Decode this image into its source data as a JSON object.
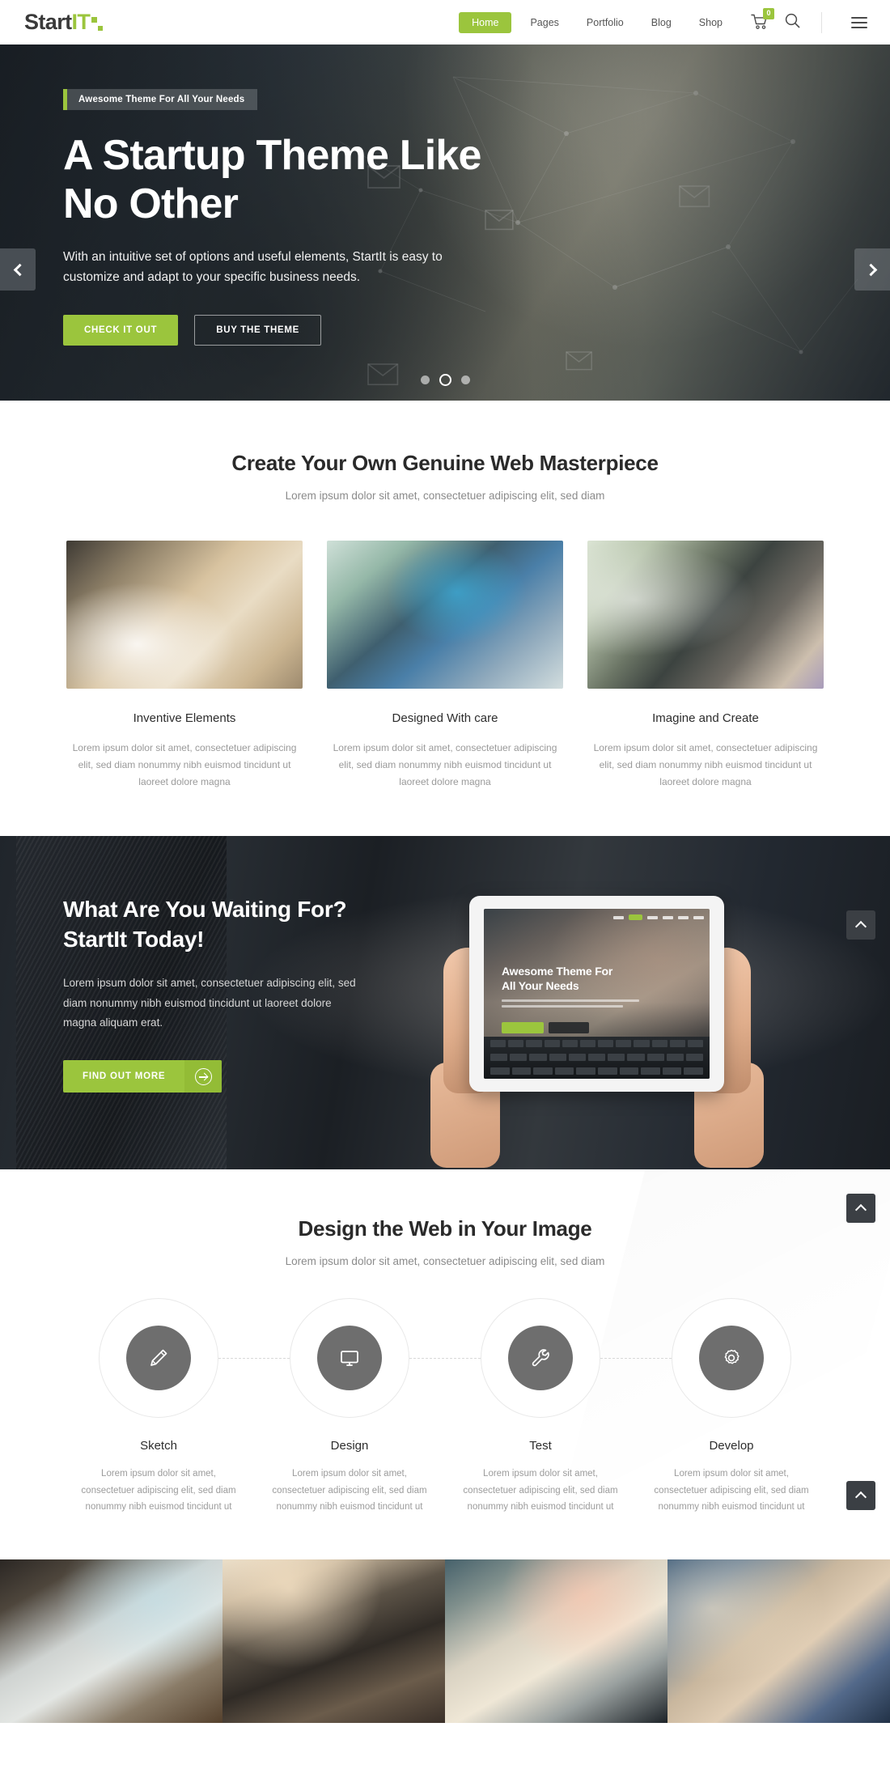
{
  "header": {
    "logo": {
      "part1": "Start",
      "part2": "IT"
    },
    "nav": [
      {
        "label": "Home",
        "active": true
      },
      {
        "label": "Pages",
        "active": false
      },
      {
        "label": "Portfolio",
        "active": false
      },
      {
        "label": "Blog",
        "active": false
      },
      {
        "label": "Shop",
        "active": false
      }
    ],
    "cart_count": "0",
    "icons": {
      "cart": "shopping-cart-icon",
      "search": "search-icon",
      "menu": "hamburger-menu-icon"
    }
  },
  "hero": {
    "tagline": "Awesome Theme For All Your Needs",
    "title_line1": "A Startup Theme Like",
    "title_line2": "No Other",
    "subtitle": "With an intuitive set of options and useful elements, StartIt is easy to customize and adapt to your specific business needs.",
    "primary_button": "CHECK IT OUT",
    "secondary_button": "BUY THE THEME",
    "slide_count": 3,
    "active_slide": 2,
    "prev_label": "Previous slide",
    "next_label": "Next slide"
  },
  "masterpiece": {
    "title": "Create Your Own Genuine Web Masterpiece",
    "subtitle": "Lorem ipsum dolor sit amet, consectetuer adipiscing elit, sed diam",
    "cards": [
      {
        "title": "Inventive Elements",
        "text": "Lorem ipsum dolor sit amet, consectetuer adipiscing elit, sed diam nonummy nibh euismod tincidunt ut laoreet dolore magna"
      },
      {
        "title": "Designed With care",
        "text": "Lorem ipsum dolor sit amet, consectetuer adipiscing elit, sed diam nonummy nibh euismod tincidunt ut laoreet dolore magna"
      },
      {
        "title": "Imagine and Create",
        "text": "Lorem ipsum dolor sit amet, consectetuer adipiscing elit, sed diam nonummy nibh euismod tincidunt ut laoreet dolore magna"
      }
    ]
  },
  "cta": {
    "title_line1": "What Are You Waiting For?",
    "title_line2": "StartIt Today!",
    "text": "Lorem ipsum dolor sit amet, consectetuer adipiscing elit, sed diam nonummy nibh euismod tincidunt ut laoreet dolore magna aliquam erat.",
    "button": "FIND OUT MORE",
    "tablet_preview": {
      "headline_line1": "Awesome Theme For",
      "headline_line2": "All Your Needs"
    }
  },
  "process": {
    "title": "Design the Web in Your Image",
    "subtitle": "Lorem ipsum dolor sit amet, consectetuer adipiscing elit, sed diam",
    "steps": [
      {
        "icon": "pencil-icon",
        "title": "Sketch",
        "text": "Lorem ipsum dolor sit amet, consectetuer adipiscing elit, sed diam nonummy nibh euismod tincidunt ut"
      },
      {
        "icon": "monitor-icon",
        "title": "Design",
        "text": "Lorem ipsum dolor sit amet, consectetuer adipiscing elit, sed diam nonummy nibh euismod tincidunt ut"
      },
      {
        "icon": "wrench-icon",
        "title": "Test",
        "text": "Lorem ipsum dolor sit amet, consectetuer adipiscing elit, sed diam nonummy nibh euismod tincidunt ut"
      },
      {
        "icon": "gear-icon",
        "title": "Develop",
        "text": "Lorem ipsum dolor sit amet, consectetuer adipiscing elit, sed diam nonummy nibh euismod tincidunt ut"
      }
    ]
  },
  "scroll_top": {
    "label": "Back to top"
  },
  "colors": {
    "accent_green": "#9bc53d",
    "dark": "#2b3238",
    "text": "#303030",
    "muted": "#9a9a9a",
    "button_dark": "#3b3f44"
  }
}
